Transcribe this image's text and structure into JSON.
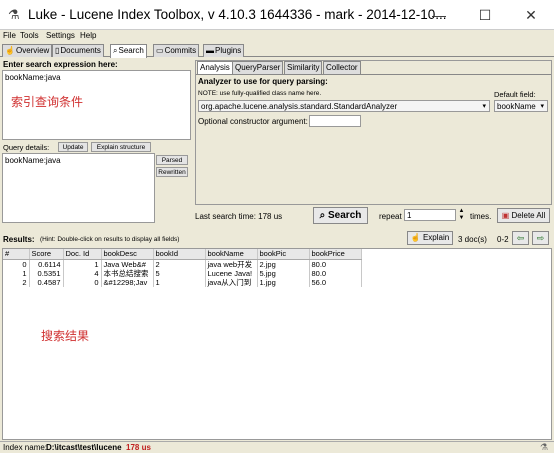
{
  "window": {
    "title": "Luke - Lucene Index Toolbox, v 4.10.3 1644336 - mark - 2014-12-10...",
    "minimize": "—",
    "maximize": "☐",
    "close": "✕"
  },
  "menu": {
    "file": "File",
    "tools": "Tools",
    "settings": "Settings",
    "help": "Help"
  },
  "tabs": {
    "overview": "Overview",
    "documents": "Documents",
    "search": "Search",
    "commits": "Commits",
    "plugins": "Plugins"
  },
  "search": {
    "expr_label": "Enter search expression here:",
    "expr_value": "bookName:java",
    "annotation_query": "索引查询条件",
    "query_details_label": "Query details:",
    "update": "Update",
    "explain_structure": "Explain structure",
    "details_value": "bookName:java",
    "parsed": "Parsed",
    "rewritten": "Rewritten"
  },
  "subtabs": {
    "analysis": "Analysis",
    "queryparser": "QueryParser",
    "similarity": "Similarity",
    "collector": "Collector"
  },
  "analysis": {
    "analyzer_label": "Analyzer to use for query parsing:",
    "note": "NOTE: use fully-qualified class name here.",
    "default_field_label": "Default field:",
    "analyzer_value": "org.apache.lucene.analysis.standard.StandardAnalyzer",
    "default_field_value": "bookName",
    "ctor_label": "Optional constructor argument:"
  },
  "searchbar": {
    "last_time": "Last search time: 178 us",
    "search": "Search",
    "repeat_label": "repeat",
    "repeat_value": "1",
    "times": "times.",
    "delete_all": "Delete All"
  },
  "results": {
    "label": "Results:",
    "hint": "(Hint: Double-click on results to display all fields)",
    "explain": "Explain",
    "doc_count": "3 doc(s)",
    "range": "0-2",
    "columns": [
      "#",
      "Score",
      "Doc. Id",
      "bookDesc",
      "bookId",
      "bookName",
      "bookPic",
      "bookPrice"
    ],
    "rows": [
      [
        "0",
        "0.6114",
        "1",
        "Java Web&#",
        "2",
        "java web开发",
        "2.jpg",
        "80.0"
      ],
      [
        "1",
        "0.5351",
        "4",
        "本书总结搜索",
        "5",
        "Lucene Java!",
        "5.jpg",
        "80.0"
      ],
      [
        "2",
        "0.4587",
        "0",
        "&#12298;Jav",
        "1",
        "java从入门到",
        "1.jpg",
        "56.0"
      ]
    ],
    "annotation_results": "搜索结果"
  },
  "status": {
    "index_label": "Index name:",
    "index_value": "D:\\itcast\\test\\lucene",
    "time": "178 us"
  }
}
